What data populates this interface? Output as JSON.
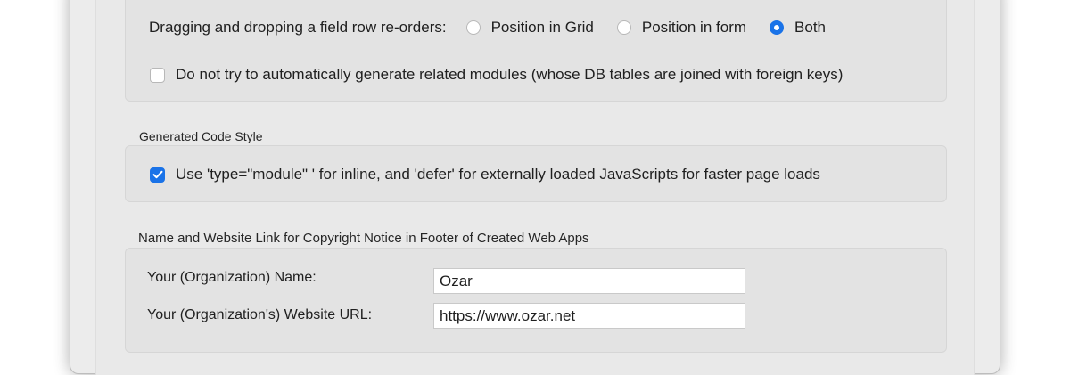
{
  "field_order": {
    "label": "Dragging and dropping a field row re-orders:",
    "options": [
      {
        "label": "Position in Grid",
        "selected": false
      },
      {
        "label": "Position in form",
        "selected": false
      },
      {
        "label": "Both",
        "selected": true
      }
    ],
    "related_modules_checkbox": {
      "label": "Do not try to automatically generate related modules (whose DB tables are joined with foreign keys)",
      "checked": false
    }
  },
  "code_style": {
    "title": "Generated Code Style",
    "module_checkbox": {
      "label": "Use 'type=\"module\" ' for inline, and 'defer' for externally loaded JavaScripts for faster page loads",
      "checked": true
    }
  },
  "copyright": {
    "title": "Name and Website Link for Copyright Notice in Footer of Created Web Apps",
    "name_label": "Your (Organization) Name:",
    "name_value": "Ozar",
    "url_label": "Your (Organization's) Website URL:",
    "url_value": "https://www.ozar.net"
  },
  "colors": {
    "accent": "#1a73e8",
    "group_background": "#e3e3e3",
    "window_background": "#ececec"
  }
}
